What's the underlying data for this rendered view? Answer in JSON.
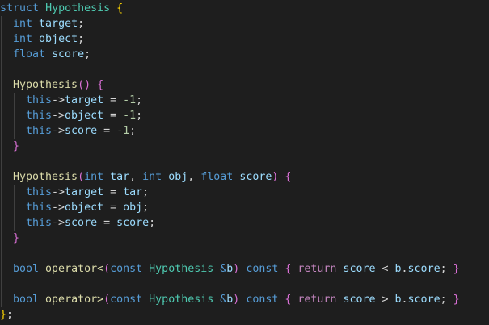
{
  "editor": {
    "language": "cpp",
    "theme": "dark",
    "colors": {
      "background": "#1e1e1e",
      "keyword": "#569cd6",
      "type": "#4ec9b0",
      "variable": "#9cdcfe",
      "function": "#dcdcaa",
      "number": "#b5cea8",
      "control": "#c586c0",
      "plain": "#d4d4d4",
      "bracket_level_1": "#ffd700",
      "bracket_level_2": "#da70d6",
      "bracket_level_3": "#179fff"
    },
    "lines": [
      {
        "indent": 0,
        "tokens": [
          [
            "kw",
            "struct"
          ],
          [
            "pl",
            " "
          ],
          [
            "ty",
            "Hypothesis"
          ],
          [
            "pl",
            " "
          ],
          [
            "b1",
            "{"
          ]
        ]
      },
      {
        "indent": 1,
        "tokens": [
          [
            "kw",
            "int"
          ],
          [
            "pl",
            " "
          ],
          [
            "id",
            "target"
          ],
          [
            "pl",
            ";"
          ]
        ]
      },
      {
        "indent": 1,
        "tokens": [
          [
            "kw",
            "int"
          ],
          [
            "pl",
            " "
          ],
          [
            "id",
            "object"
          ],
          [
            "pl",
            ";"
          ]
        ]
      },
      {
        "indent": 1,
        "tokens": [
          [
            "kw",
            "float"
          ],
          [
            "pl",
            " "
          ],
          [
            "id",
            "score"
          ],
          [
            "pl",
            ";"
          ]
        ]
      },
      {
        "indent": 1,
        "tokens": []
      },
      {
        "indent": 1,
        "tokens": [
          [
            "fn",
            "Hypothesis"
          ],
          [
            "b2",
            "("
          ],
          [
            "b2",
            ")"
          ],
          [
            "pl",
            " "
          ],
          [
            "b2",
            "{"
          ]
        ]
      },
      {
        "indent": 2,
        "tokens": [
          [
            "kw",
            "this"
          ],
          [
            "pl",
            "->"
          ],
          [
            "id",
            "target"
          ],
          [
            "pl",
            " = "
          ],
          [
            "nm",
            "-1"
          ],
          [
            "pl",
            ";"
          ]
        ]
      },
      {
        "indent": 2,
        "tokens": [
          [
            "kw",
            "this"
          ],
          [
            "pl",
            "->"
          ],
          [
            "id",
            "object"
          ],
          [
            "pl",
            " = "
          ],
          [
            "nm",
            "-1"
          ],
          [
            "pl",
            ";"
          ]
        ]
      },
      {
        "indent": 2,
        "tokens": [
          [
            "kw",
            "this"
          ],
          [
            "pl",
            "->"
          ],
          [
            "id",
            "score"
          ],
          [
            "pl",
            " = "
          ],
          [
            "nm",
            "-1"
          ],
          [
            "pl",
            ";"
          ]
        ]
      },
      {
        "indent": 1,
        "tokens": [
          [
            "b2",
            "}"
          ]
        ]
      },
      {
        "indent": 1,
        "tokens": []
      },
      {
        "indent": 1,
        "tokens": [
          [
            "fn",
            "Hypothesis"
          ],
          [
            "b2",
            "("
          ],
          [
            "kw",
            "int"
          ],
          [
            "pl",
            " "
          ],
          [
            "id",
            "tar"
          ],
          [
            "pl",
            ", "
          ],
          [
            "kw",
            "int"
          ],
          [
            "pl",
            " "
          ],
          [
            "id",
            "obj"
          ],
          [
            "pl",
            ", "
          ],
          [
            "kw",
            "float"
          ],
          [
            "pl",
            " "
          ],
          [
            "id",
            "score"
          ],
          [
            "b2",
            ")"
          ],
          [
            "pl",
            " "
          ],
          [
            "b2",
            "{"
          ]
        ]
      },
      {
        "indent": 2,
        "tokens": [
          [
            "kw",
            "this"
          ],
          [
            "pl",
            "->"
          ],
          [
            "id",
            "target"
          ],
          [
            "pl",
            " = "
          ],
          [
            "id",
            "tar"
          ],
          [
            "pl",
            ";"
          ]
        ]
      },
      {
        "indent": 2,
        "tokens": [
          [
            "kw",
            "this"
          ],
          [
            "pl",
            "->"
          ],
          [
            "id",
            "object"
          ],
          [
            "pl",
            " = "
          ],
          [
            "id",
            "obj"
          ],
          [
            "pl",
            ";"
          ]
        ]
      },
      {
        "indent": 2,
        "tokens": [
          [
            "kw",
            "this"
          ],
          [
            "pl",
            "->"
          ],
          [
            "id",
            "score"
          ],
          [
            "pl",
            " = "
          ],
          [
            "id",
            "score"
          ],
          [
            "pl",
            ";"
          ]
        ]
      },
      {
        "indent": 1,
        "tokens": [
          [
            "b2",
            "}"
          ]
        ]
      },
      {
        "indent": 1,
        "tokens": []
      },
      {
        "indent": 1,
        "tokens": [
          [
            "kw",
            "bool"
          ],
          [
            "pl",
            " "
          ],
          [
            "fn",
            "operator<"
          ],
          [
            "b2",
            "("
          ],
          [
            "kw",
            "const"
          ],
          [
            "pl",
            " "
          ],
          [
            "ty",
            "Hypothesis"
          ],
          [
            "pl",
            " "
          ],
          [
            "kw",
            "&"
          ],
          [
            "id",
            "b"
          ],
          [
            "b2",
            ")"
          ],
          [
            "pl",
            " "
          ],
          [
            "kw",
            "const"
          ],
          [
            "pl",
            " "
          ],
          [
            "b2",
            "{"
          ],
          [
            "pl",
            " "
          ],
          [
            "ctl",
            "return"
          ],
          [
            "pl",
            " "
          ],
          [
            "id",
            "score"
          ],
          [
            "pl",
            " < "
          ],
          [
            "id",
            "b"
          ],
          [
            "pl",
            "."
          ],
          [
            "id",
            "score"
          ],
          [
            "pl",
            "; "
          ],
          [
            "b2",
            "}"
          ]
        ]
      },
      {
        "indent": 1,
        "tokens": []
      },
      {
        "indent": 1,
        "tokens": [
          [
            "kw",
            "bool"
          ],
          [
            "pl",
            " "
          ],
          [
            "fn",
            "operator>"
          ],
          [
            "b2",
            "("
          ],
          [
            "kw",
            "const"
          ],
          [
            "pl",
            " "
          ],
          [
            "ty",
            "Hypothesis"
          ],
          [
            "pl",
            " "
          ],
          [
            "kw",
            "&"
          ],
          [
            "id",
            "b"
          ],
          [
            "b2",
            ")"
          ],
          [
            "pl",
            " "
          ],
          [
            "kw",
            "const"
          ],
          [
            "pl",
            " "
          ],
          [
            "b2",
            "{"
          ],
          [
            "pl",
            " "
          ],
          [
            "ctl",
            "return"
          ],
          [
            "pl",
            " "
          ],
          [
            "id",
            "score"
          ],
          [
            "pl",
            " > "
          ],
          [
            "id",
            "b"
          ],
          [
            "pl",
            "."
          ],
          [
            "id",
            "score"
          ],
          [
            "pl",
            "; "
          ],
          [
            "b2",
            "}"
          ]
        ]
      },
      {
        "indent": 0,
        "tokens": [
          [
            "b1",
            "}"
          ],
          [
            "pl",
            ";"
          ]
        ]
      }
    ]
  }
}
